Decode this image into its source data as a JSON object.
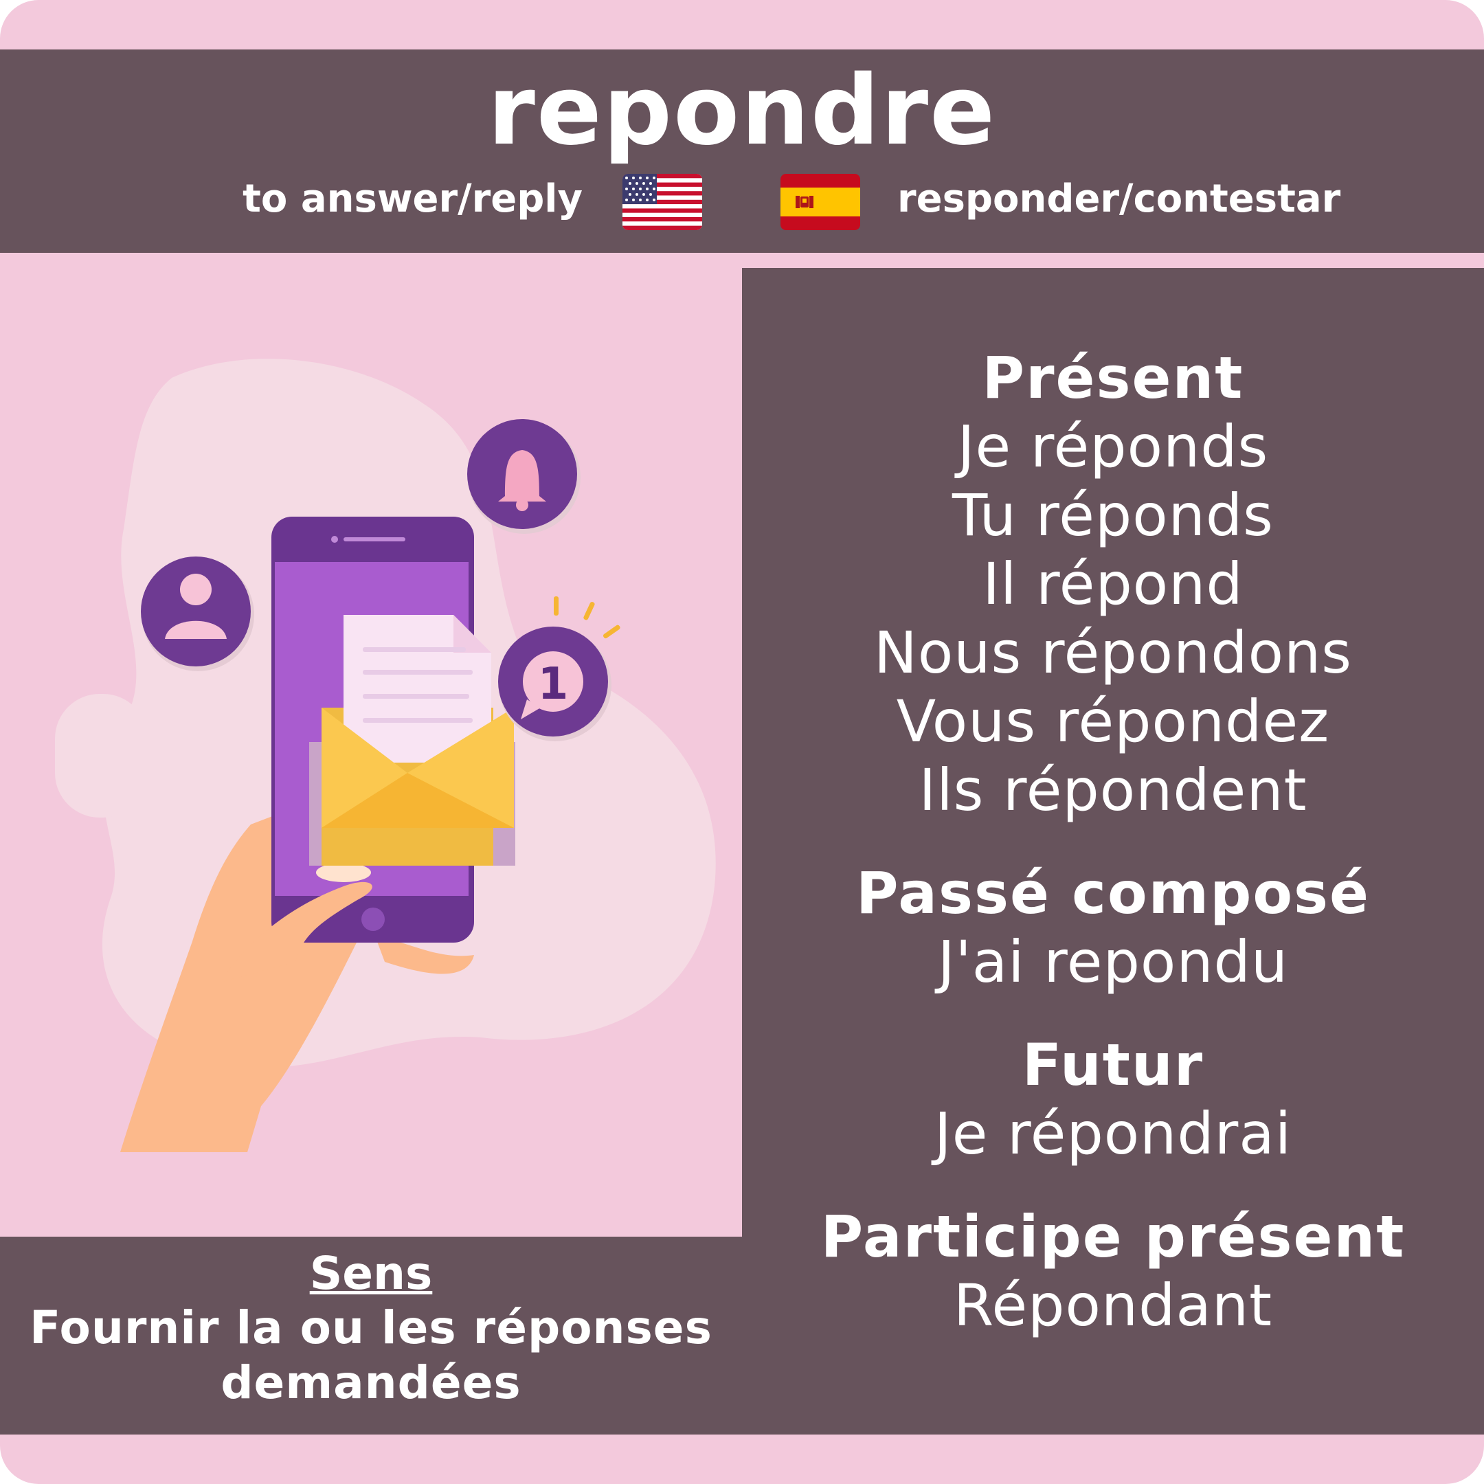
{
  "title": "repondre",
  "translations": {
    "en": "to answer/reply",
    "es": "responder/contestar"
  },
  "icons": {
    "flag_us": "us-flag-icon",
    "flag_es": "spain-flag-icon",
    "illustration": "phone-message-illustration"
  },
  "conjugation": {
    "present": {
      "heading": "Présent",
      "forms": [
        "Je réponds",
        "Tu réponds",
        "Il répond",
        "Nous répondons",
        "Vous répondez",
        "Ils répondent"
      ]
    },
    "passe_compose": {
      "heading": "Passé composé",
      "form": "J'ai repondu"
    },
    "futur": {
      "heading": "Futur",
      "form": "Je répondrai"
    },
    "participe_present": {
      "heading": "Participe présent",
      "form": "Répondant"
    }
  },
  "sens": {
    "label": "Sens",
    "definition": "Fournir la ou les réponses demandées"
  },
  "colors": {
    "background": "#f3c9dc",
    "panel": "#67535c",
    "text": "#ffffff"
  }
}
